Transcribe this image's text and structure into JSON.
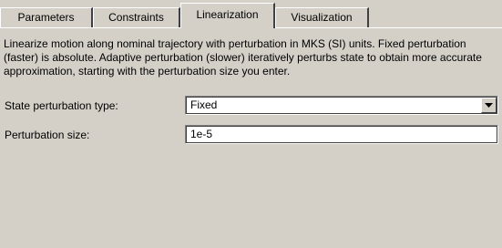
{
  "tabs": [
    {
      "label": "Parameters",
      "active": false
    },
    {
      "label": "Constraints",
      "active": false
    },
    {
      "label": "Linearization",
      "active": true
    },
    {
      "label": "Visualization",
      "active": false
    }
  ],
  "description": "Linearize motion along nominal trajectory with perturbation in MKS (SI) units.  Fixed perturbation (faster) is absolute. Adaptive perturbation (slower) iteratively perturbs state to obtain more accurate approximation, starting with the perturbation size you enter.",
  "state_perturbation": {
    "label": "State perturbation type:",
    "value": "Fixed",
    "icon": "dropdown-arrow-icon"
  },
  "perturbation_size": {
    "label": "Perturbation size:",
    "value": "1e-5"
  }
}
